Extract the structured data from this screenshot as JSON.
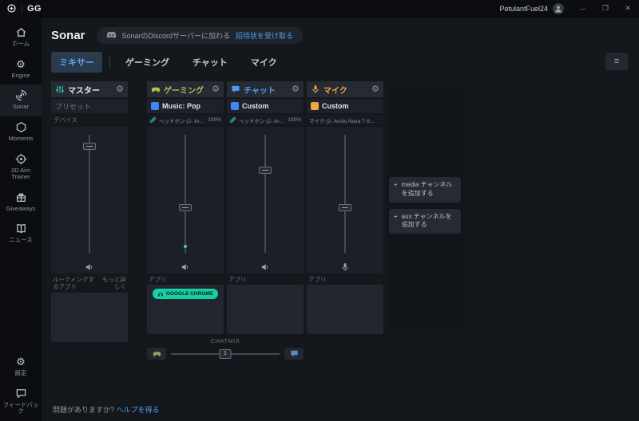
{
  "colors": {
    "accent_link": "#4d9fec",
    "active_tab_bg": "#2a3b4e",
    "master": "#e8ebef",
    "master_icon": "#2bd4c3",
    "gaming": "#a3c852",
    "chat": "#4f9cf0",
    "mic": "#f0a63c",
    "chrome_badge": "#17cfa6",
    "level_dot": "#2dd4bf",
    "preset_icon_gaming": "#4285f4",
    "preset_icon_chat": "#4285f4",
    "preset_icon_mic": "#f0a63c"
  },
  "icons": {
    "gear": "⚙",
    "menu": "≡",
    "minimize": "─",
    "maximize": "❐",
    "close": "✕",
    "plus": "+"
  },
  "titlebar": {
    "app_name": "GG",
    "username": "PetulantFuel24"
  },
  "sidebar": {
    "items": [
      {
        "label": "ホーム"
      },
      {
        "label": "Engine"
      },
      {
        "label": "Sonar"
      },
      {
        "label": "Moments"
      },
      {
        "label": "3D Aim Trainer"
      },
      {
        "label": "Giveaways"
      },
      {
        "label": "ニュース"
      }
    ],
    "settings": {
      "label": "設定"
    },
    "feedback": {
      "label": "フィードバック"
    }
  },
  "header": {
    "title": "Sonar",
    "discord_text": "SonarのDiscordサーバーに加わる",
    "discord_link": "招待状を受け取る"
  },
  "tabs": {
    "mixer": "ミキサー",
    "gaming": "ゲーミング",
    "chat": "チャット",
    "mic": "マイク"
  },
  "mixer": {
    "row_labels": {
      "preset": "プリセット",
      "device": "デバイス"
    },
    "channels": [
      {
        "name": "マスター",
        "color": "#e8ebef",
        "volume": 90,
        "apps_label": "ルーティングするアプリ",
        "more_link": "もっと詳しく"
      },
      {
        "name": "ゲーミング",
        "color": "#a3c852",
        "preset": "Music: Pop",
        "device": "ヘッドホン (2- Arctis ...",
        "device_pct": "100%",
        "volume": 38,
        "apps_label": "アプリ",
        "app_badge": "GOOGLE CHROME"
      },
      {
        "name": "チャット",
        "color": "#4f9cf0",
        "preset": "Custom",
        "device": "ヘッドホン (2- Arctis ...",
        "device_pct": "100%",
        "volume": 70,
        "apps_label": "アプリ"
      },
      {
        "name": "マイク",
        "color": "#f0a63c",
        "preset": "Custom",
        "device": "マイク (2- Arctis Nova 7 G...",
        "volume": 38,
        "apps_label": "アプリ"
      }
    ],
    "chatmix": {
      "label": "CHATMIX",
      "value": "1"
    }
  },
  "add_channels": [
    {
      "label": "media チャンネルを追加する"
    },
    {
      "label": "aux チャンネルを追加する"
    }
  ],
  "footer": {
    "question": "問題がありますか?",
    "link": "ヘルプを得る"
  }
}
